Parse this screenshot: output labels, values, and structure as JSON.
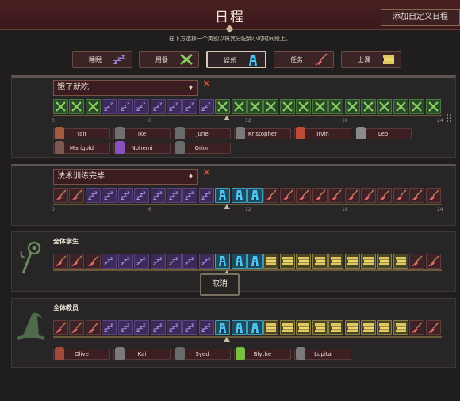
{
  "header": {
    "title": "日程",
    "custom_button": "添加自定义日程"
  },
  "hint": "在下方选择一个类别以将其分配到小时时间段上。",
  "activities": [
    {
      "key": "sleep",
      "label": "睡眠",
      "icon": "zzz-icon"
    },
    {
      "key": "eat",
      "label": "用餐",
      "icon": "fork-knife-icon"
    },
    {
      "key": "play",
      "label": "娱乐",
      "icon": "blue-statue-icon",
      "selected": true
    },
    {
      "key": "task",
      "label": "任务",
      "icon": "broom-icon"
    },
    {
      "key": "class",
      "label": "上课",
      "icon": "books-icon"
    }
  ],
  "colors": {
    "sleep": "#3c2a59",
    "eat": "#2b4a29",
    "play": "#1d4a5c",
    "task": "#3d2226",
    "class": "#4a4526",
    "delete": "#e2502c"
  },
  "timeline_labels": [
    "0",
    "6",
    "12",
    "18",
    "24"
  ],
  "schedules": [
    {
      "name": "饿了就吃",
      "pin_symbol": "♦",
      "slots": [
        "eat",
        "eat",
        "eat",
        "sleep",
        "sleep",
        "sleep",
        "sleep",
        "sleep",
        "sleep",
        "sleep",
        "eat",
        "eat",
        "eat",
        "eat",
        "eat",
        "eat",
        "eat",
        "eat",
        "eat",
        "eat",
        "eat",
        "eat",
        "eat",
        "eat"
      ],
      "pawns": [
        "Yair",
        "Ike",
        "June",
        "Kristopher",
        "Irvin",
        "Leo",
        "Marigold",
        "Nohemi",
        "Orion"
      ]
    },
    {
      "name": "法术训练完毕",
      "pin_symbol": "♦",
      "slots": [
        "task",
        "task",
        "sleep",
        "sleep",
        "sleep",
        "sleep",
        "sleep",
        "sleep",
        "sleep",
        "sleep",
        "play",
        "play",
        "play",
        "task",
        "task",
        "task",
        "task",
        "task",
        "task",
        "task",
        "task",
        "task",
        "task",
        "task"
      ],
      "pawns": []
    },
    {
      "name": "全体学生",
      "group_icon": "staff-icon",
      "slots": [
        "task",
        "task",
        "task",
        "sleep",
        "sleep",
        "sleep",
        "sleep",
        "sleep",
        "sleep",
        "sleep",
        "play",
        "play",
        "play",
        "class",
        "class",
        "class",
        "class",
        "class",
        "class",
        "class",
        "class",
        "class",
        "task",
        "task"
      ],
      "pawns": []
    },
    {
      "name": "全体教员",
      "group_icon": "witch-hat-icon",
      "slots": [
        "task",
        "task",
        "task",
        "sleep",
        "sleep",
        "sleep",
        "sleep",
        "sleep",
        "sleep",
        "sleep",
        "play",
        "play",
        "play",
        "class",
        "class",
        "class",
        "class",
        "class",
        "class",
        "class",
        "class",
        "class",
        "task",
        "task"
      ],
      "pawns": [
        "Olive",
        "Kai",
        "Syed",
        "Blythe",
        "Lupita"
      ]
    }
  ],
  "cancel_button": "取消"
}
